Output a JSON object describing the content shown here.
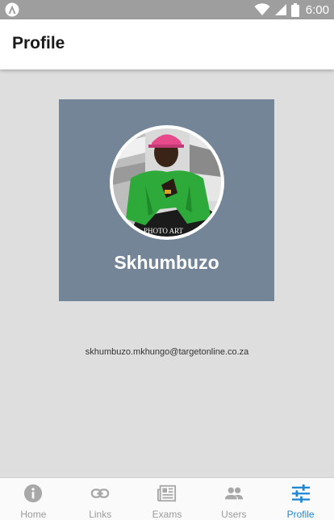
{
  "status_bar": {
    "time": "6:00",
    "icons": [
      "app-logo-icon",
      "wifi-icon",
      "signal-icon",
      "battery-icon"
    ],
    "color": "#9e9e9e"
  },
  "app_bar": {
    "title": "Profile"
  },
  "profile": {
    "name": "Skhumbuzo",
    "email": "skhumbuzo.mkhungo@targetonline.co.za",
    "card_color": "#738597",
    "avatar_watermark": "PHOTO ART"
  },
  "bottom_nav": {
    "items": [
      {
        "label": "Home",
        "icon": "info-icon",
        "active": false
      },
      {
        "label": "Links",
        "icon": "link-icon",
        "active": false
      },
      {
        "label": "Exams",
        "icon": "newspaper-icon",
        "active": false
      },
      {
        "label": "Users",
        "icon": "people-icon",
        "active": false
      },
      {
        "label": "Profile",
        "icon": "sliders-icon",
        "active": true
      }
    ],
    "active_color": "#1f88d6",
    "inactive_color": "#9a9a9a"
  }
}
